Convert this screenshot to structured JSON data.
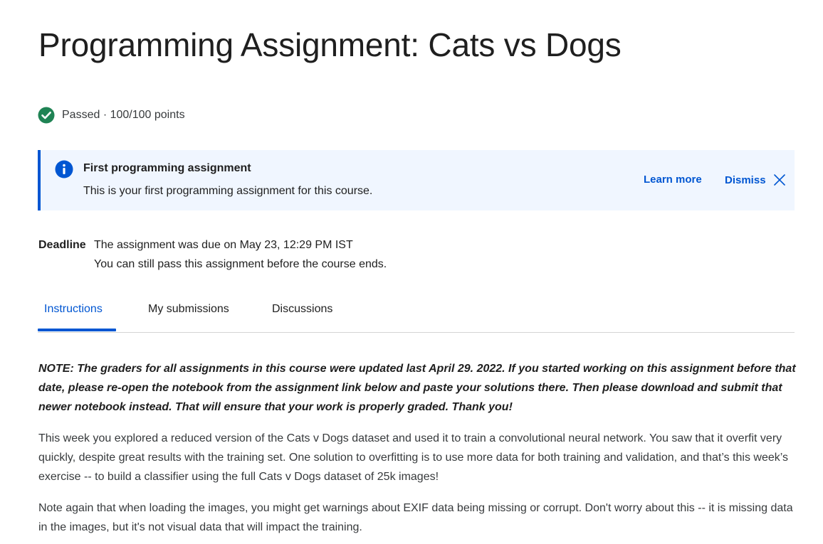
{
  "page": {
    "title": "Programming Assignment: Cats vs Dogs"
  },
  "status": {
    "icon": "check-circle-icon",
    "color": "#1f8354",
    "text": "Passed · 100/100 points"
  },
  "banner": {
    "icon": "info-icon",
    "accent": "#0056d2",
    "background": "#f0f6ff",
    "title": "First programming assignment",
    "body": "This is your first programming assignment for this course.",
    "learn_more_label": "Learn more",
    "dismiss_label": "Dismiss",
    "dismiss_icon": "close-icon"
  },
  "deadline": {
    "label": "Deadline",
    "line1": "The assignment was due on May 23, 12:29 PM IST",
    "line2": "You can still pass this assignment before the course ends."
  },
  "tabs": [
    {
      "label": "Instructions",
      "active": true
    },
    {
      "label": "My submissions",
      "active": false
    },
    {
      "label": "Discussions",
      "active": false
    }
  ],
  "content": {
    "note": "NOTE: The graders for all assignments in this course were updated last April 29. 2022. If you started working on this assignment before that date, please re-open the notebook from the assignment link below and paste your solutions there. Then please download and submit that newer notebook instead. That will ensure that your work is properly graded. Thank you!",
    "paragraph1": "This week you explored a reduced version of the Cats v Dogs dataset and used it to train a convolutional neural network. You saw that it overfit very quickly, despite great results with the training set. One solution to overfitting is to use more data for both training and validation, and that’s this week’s exercise -- to build a classifier using the full Cats v Dogs dataset of 25k images!",
    "paragraph2": "Note again that when loading the images, you might get warnings about EXIF data being missing or corrupt. Don't worry about this -- it is missing data in the images, but it's not visual data that will impact the training."
  }
}
